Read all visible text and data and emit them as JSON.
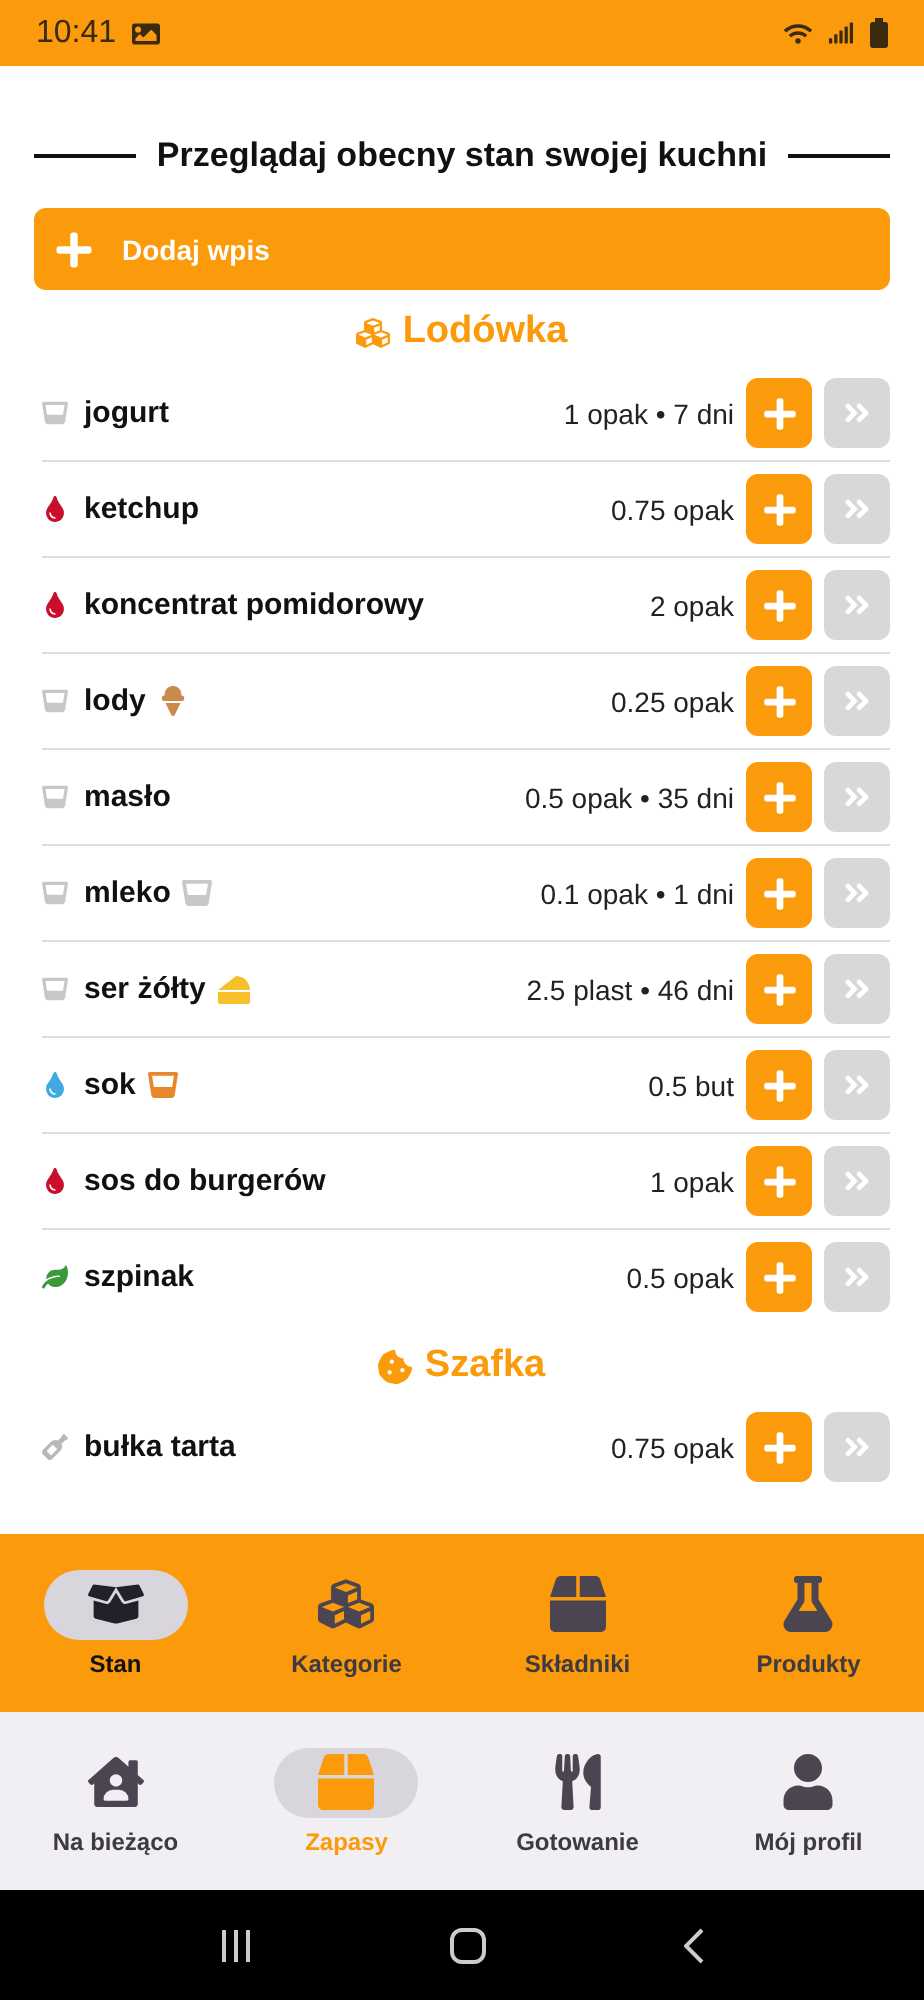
{
  "status_bar": {
    "time": "10:41"
  },
  "header": {
    "title": "Przeglądaj obecny stan swojej kuchni",
    "add_button": "Dodaj wpis"
  },
  "sections": [
    {
      "title": "Lodówka",
      "kind": "cubes",
      "items": [
        {
          "name": "jogurt",
          "kind": "cup",
          "reading": "1 opak • 7 dni"
        },
        {
          "name": "ketchup",
          "kind": "drop",
          "color": "#c8102e",
          "reading": "0.75 opak"
        },
        {
          "name": "koncentrat pomidorowy",
          "kind": "drop",
          "color": "#c8102e",
          "reading": "2 opak"
        },
        {
          "name": "lody",
          "kind": "cup_icecream",
          "reading": "0.25 opak"
        },
        {
          "name": "masło",
          "kind": "cup",
          "reading": "0.5 opak • 35 dni"
        },
        {
          "name": "mleko",
          "kind": "cup_milk",
          "reading": "0.1 opak • 1 dni"
        },
        {
          "name": "ser żółty",
          "kind": "cup_cheese",
          "reading": "2.5 plast • 46 dni"
        },
        {
          "name": "sok",
          "kind": "drop_juice",
          "color": "#3fa9e0",
          "reading": "0.5 but"
        },
        {
          "name": "sos do burgerów",
          "kind": "drop",
          "color": "#c8102e",
          "reading": "1 opak"
        },
        {
          "name": "szpinak",
          "kind": "leaf",
          "reading": "0.5 opak"
        }
      ]
    },
    {
      "title": "Szafka",
      "kind": "cookie",
      "items": [
        {
          "name": "bułka tarta",
          "kind": "shaker",
          "reading": "0.75 opak"
        }
      ]
    }
  ],
  "top_nav": [
    {
      "label": "Stan",
      "kind": "box_open",
      "selected": true
    },
    {
      "label": "Kategorie",
      "kind": "boxes",
      "selected": false
    },
    {
      "label": "Składniki",
      "kind": "box",
      "selected": false
    },
    {
      "label": "Produkty",
      "kind": "flask",
      "selected": false
    }
  ],
  "bottom_nav": [
    {
      "label": "Na bieżąco",
      "kind": "house",
      "selected": false
    },
    {
      "label": "Zapasy",
      "kind": "box",
      "selected": true
    },
    {
      "label": "Gotowanie",
      "kind": "utensils",
      "selected": false
    },
    {
      "label": "Mój profil",
      "kind": "user",
      "selected": false
    }
  ]
}
